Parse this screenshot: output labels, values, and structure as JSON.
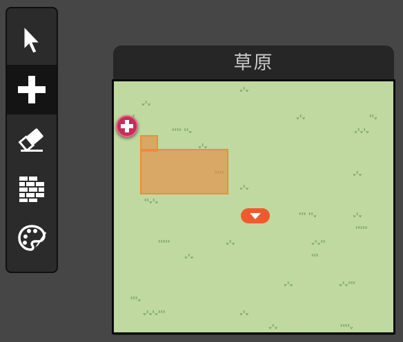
{
  "toolbar": {
    "tools": [
      {
        "name": "select",
        "icon": "cursor-icon",
        "active": false
      },
      {
        "name": "add",
        "icon": "plus-icon",
        "active": true
      },
      {
        "name": "eraser",
        "icon": "eraser-icon",
        "active": false
      },
      {
        "name": "bricks",
        "icon": "bricks-icon",
        "active": false
      },
      {
        "name": "palette",
        "icon": "palette-icon",
        "active": false
      }
    ]
  },
  "panel": {
    "title": "草原"
  },
  "colors": {
    "background": "#464646",
    "toolbar": "#2b2b2b",
    "grass_field": "#bfd9a0",
    "grass_tuft": "#6f9a5e",
    "selection": "#f08b3e",
    "add_marker": "#c62d5a",
    "drop_marker": "#ee5a2e"
  }
}
